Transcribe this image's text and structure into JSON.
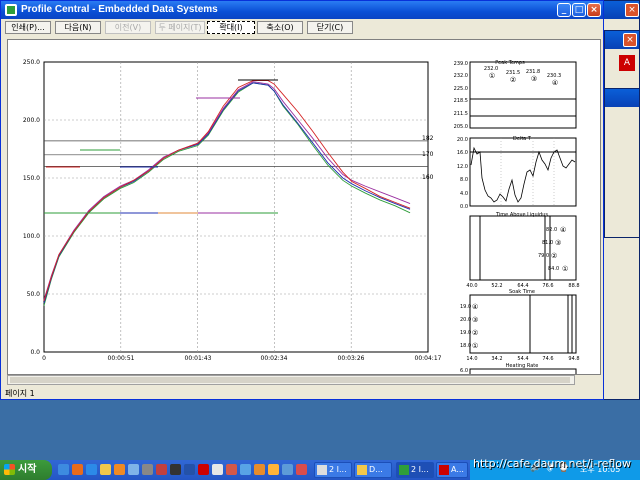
{
  "window": {
    "title": "Profile Central - Embedded Data Systems",
    "minimize_glyph": "_",
    "maximize_glyph": "□",
    "close_glyph": "×"
  },
  "toolbar": {
    "buttons": [
      {
        "label": "인쇄(P)...",
        "enabled": true
      },
      {
        "label": "다음(N)",
        "enabled": true
      },
      {
        "label": "이전(V)",
        "enabled": false
      },
      {
        "label": "두 페이지(T)",
        "enabled": false
      },
      {
        "label": "확대(I)",
        "enabled": true,
        "active": true
      },
      {
        "label": "축소(O)",
        "enabled": true
      },
      {
        "label": "닫기(C)",
        "enabled": true
      }
    ]
  },
  "status": {
    "page_label": "페이지 1"
  },
  "main_chart": {
    "y_ticks": [
      "250.0",
      "200.0",
      "150.0",
      "100.0",
      "50.0",
      "0.0"
    ],
    "x_ticks": [
      "0",
      "00:00:51",
      "00:01:43",
      "00:02:34",
      "00:03:26",
      "00:04:17"
    ],
    "ref_labels": [
      "182",
      "170",
      "160"
    ]
  },
  "panel_peak": {
    "title": "Peak Temps",
    "y_ticks": [
      "239.0",
      "232.0",
      "225.0",
      "218.5",
      "211.5",
      "205.0"
    ],
    "values": [
      {
        "value": "232.0",
        "channel": "①"
      },
      {
        "value": "231.5",
        "channel": "②"
      },
      {
        "value": "231.8",
        "channel": "③"
      },
      {
        "value": "230.3",
        "channel": "④"
      }
    ]
  },
  "panel_delta": {
    "title": "Delta T",
    "y_ticks": [
      "20.0",
      "16.0",
      "12.0",
      "8.0",
      "4.0",
      "0.0"
    ],
    "line_color": "#000000",
    "ref_color": "#000000"
  },
  "panel_soak": {
    "title": "Time Above Liquidus",
    "x_ticks": [
      "40.0",
      "52.2",
      "64.4",
      "76.6",
      "88.8"
    ],
    "values": [
      {
        "value": "82.0",
        "channel": "④"
      },
      {
        "value": "81.0",
        "channel": "③"
      },
      {
        "value": "79.0",
        "channel": "②"
      },
      {
        "value": "84.0",
        "channel": "①"
      }
    ]
  },
  "panel_time": {
    "title": "Soak Time",
    "x_ticks": [
      "14.0",
      "34.2",
      "54.4",
      "74.6",
      "94.8"
    ],
    "values": [
      {
        "value": "19.0",
        "channel": "④"
      },
      {
        "value": "20.0",
        "channel": "③"
      },
      {
        "value": "19.0",
        "channel": "②"
      },
      {
        "value": "18.0",
        "channel": "①"
      }
    ]
  },
  "panel_bottom": {
    "title": "Heating Rate",
    "first_tick": "6.0"
  },
  "taskbar": {
    "start_label": "시작",
    "tasks": [
      "2 I...",
      "D...",
      "2 I...",
      "A..."
    ],
    "tray_icons": [
      "🔊",
      "🛡",
      "⌚"
    ],
    "clock": "오후 10:05"
  },
  "watermark": "http://cafe.daum.net/i-reflow",
  "chart_data": {
    "type": "line",
    "title": "",
    "xlabel": "",
    "ylabel": "",
    "xlim": [
      0,
      257
    ],
    "ylim": [
      0,
      250
    ],
    "x": [
      0,
      5,
      10,
      20,
      30,
      40,
      51,
      60,
      70,
      80,
      90,
      103,
      110,
      120,
      130,
      140,
      150,
      154,
      160,
      170,
      180,
      190,
      200,
      206,
      215,
      225,
      235,
      245
    ],
    "series": [
      {
        "name": "①",
        "color": "#2e9d3a",
        "values": [
          40,
          63,
          82,
          103,
          120,
          132,
          141,
          146,
          155,
          166,
          173,
          178,
          187,
          208,
          224,
          232,
          230,
          225,
          212,
          196,
          178,
          161,
          148,
          143,
          137,
          131,
          126,
          120
        ]
      },
      {
        "name": "②",
        "color": "#1f2fb0",
        "values": [
          42,
          64,
          83,
          104,
          121,
          133,
          142,
          147,
          156,
          167,
          174,
          179,
          188,
          209,
          225,
          232,
          230,
          225,
          213,
          197,
          180,
          163,
          150,
          145,
          139,
          133,
          128,
          123
        ]
      },
      {
        "name": "③",
        "color": "#9a2fa0",
        "values": [
          45,
          66,
          84,
          105,
          122,
          134,
          143,
          148,
          157,
          168,
          174,
          180,
          189,
          210,
          226,
          233,
          231,
          227,
          216,
          200,
          184,
          167,
          153,
          148,
          143,
          138,
          133,
          128
        ]
      },
      {
        "name": "④",
        "color": "#d42424",
        "values": [
          44,
          65,
          84,
          104,
          121,
          133,
          142,
          148,
          156,
          167,
          174,
          180,
          190,
          212,
          228,
          234,
          234,
          231,
          222,
          207,
          190,
          172,
          155,
          147,
          141,
          134,
          129,
          124
        ]
      }
    ],
    "reference_lines": [
      {
        "label": "182",
        "y": 182
      },
      {
        "label": "170",
        "y": 170
      },
      {
        "label": "160",
        "y": 160
      }
    ]
  }
}
